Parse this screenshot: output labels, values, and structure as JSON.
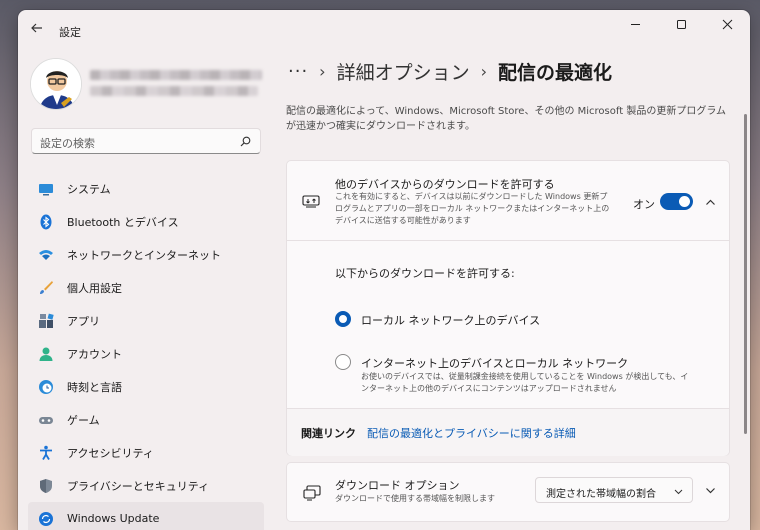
{
  "window": {
    "app_title": "設定",
    "controls": [
      "minimize",
      "maximize",
      "close"
    ]
  },
  "sidebar": {
    "search_placeholder": "設定の検索",
    "items": [
      {
        "label": "システム",
        "icon": "monitor-icon"
      },
      {
        "label": "Bluetooth とデバイス",
        "icon": "bluetooth-icon"
      },
      {
        "label": "ネットワークとインターネット",
        "icon": "wifi-icon"
      },
      {
        "label": "個人用設定",
        "icon": "brush-icon"
      },
      {
        "label": "アプリ",
        "icon": "apps-icon"
      },
      {
        "label": "アカウント",
        "icon": "person-icon"
      },
      {
        "label": "時刻と言語",
        "icon": "globe-clock-icon"
      },
      {
        "label": "ゲーム",
        "icon": "gamepad-icon"
      },
      {
        "label": "アクセシビリティ",
        "icon": "accessibility-icon"
      },
      {
        "label": "プライバシーとセキュリティ",
        "icon": "shield-icon"
      },
      {
        "label": "Windows Update",
        "icon": "update-icon"
      }
    ]
  },
  "breadcrumb": {
    "more": "···",
    "parent": "詳細オプション",
    "current": "配信の最適化"
  },
  "description": "配信の最適化によって、Windows、Microsoft Store、その他の Microsoft 製品の更新プログラムが迅速かつ確実にダウンロードされます。",
  "allow_card": {
    "title": "他のデバイスからのダウンロードを許可する",
    "description": "これを有効にすると、デバイスは以前にダウンロードした Windows 更新プログラムとアプリの一部をローカル ネットワークまたはインターネット上のデバイスに送信する可能性があります",
    "toggle_state": "オン",
    "toggle_on": true,
    "section_label": "以下からのダウンロードを許可する:",
    "options": [
      {
        "label": "ローカル ネットワーク上のデバイス",
        "checked": true,
        "description": ""
      },
      {
        "label": "インターネット上のデバイスとローカル ネットワーク",
        "checked": false,
        "description": "お使いのデバイスでは、従量制課金接続を使用していることを Windows が検出しても、インターネット上の他のデバイスにコンテンツはアップロードされません"
      }
    ],
    "related_label": "関連リンク",
    "related_link": "配信の最適化とプライバシーに関する詳細"
  },
  "download_card": {
    "title": "ダウンロード オプション",
    "description": "ダウンロードで使用する帯域幅を制限します",
    "dropdown_value": "測定された帯域幅の割合"
  },
  "colors": {
    "accent": "#0a5bb5",
    "window_bg": "#f3eeef",
    "card_bg": "#fbf9fa"
  }
}
